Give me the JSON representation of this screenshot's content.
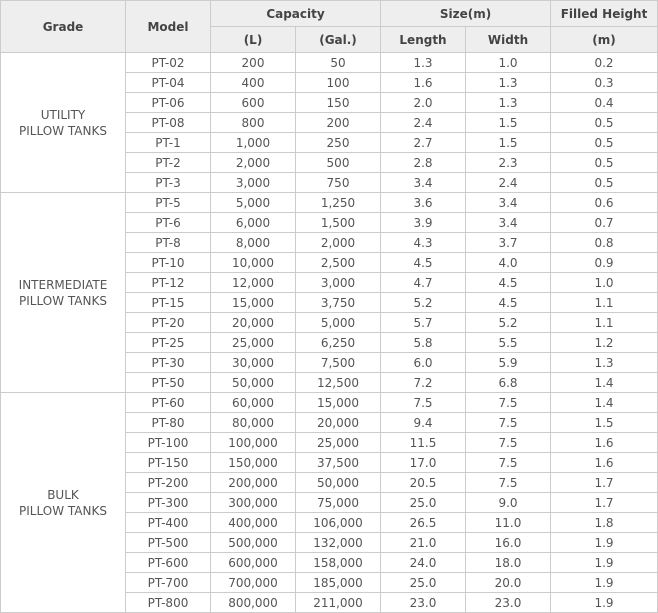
{
  "headers": {
    "grade": "Grade",
    "model": "Model",
    "capacity": "Capacity",
    "size": "Size(m)",
    "filled_height": "Filled Height",
    "liters": "(L)",
    "gallons": "(Gal.)",
    "length": "Length",
    "width": "Width",
    "meters": "(m)"
  },
  "groups": [
    {
      "grade": [
        "UTILITY",
        "PILLOW TANKS"
      ],
      "rows": [
        [
          "PT-02",
          "200",
          "50",
          "1.3",
          "1.0",
          "0.2"
        ],
        [
          "PT-04",
          "400",
          "100",
          "1.6",
          "1.3",
          "0.3"
        ],
        [
          "PT-06",
          "600",
          "150",
          "2.0",
          "1.3",
          "0.4"
        ],
        [
          "PT-08",
          "800",
          "200",
          "2.4",
          "1.5",
          "0.5"
        ],
        [
          "PT-1",
          "1,000",
          "250",
          "2.7",
          "1.5",
          "0.5"
        ],
        [
          "PT-2",
          "2,000",
          "500",
          "2.8",
          "2.3",
          "0.5"
        ],
        [
          "PT-3",
          "3,000",
          "750",
          "3.4",
          "2.4",
          "0.5"
        ]
      ]
    },
    {
      "grade": [
        "INTERMEDIATE",
        "PILLOW TANKS"
      ],
      "rows": [
        [
          "PT-5",
          "5,000",
          "1,250",
          "3.6",
          "3.4",
          "0.6"
        ],
        [
          "PT-6",
          "6,000",
          "1,500",
          "3.9",
          "3.4",
          "0.7"
        ],
        [
          "PT-8",
          "8,000",
          "2,000",
          "4.3",
          "3.7",
          "0.8"
        ],
        [
          "PT-10",
          "10,000",
          "2,500",
          "4.5",
          "4.0",
          "0.9"
        ],
        [
          "PT-12",
          "12,000",
          "3,000",
          "4.7",
          "4.5",
          "1.0"
        ],
        [
          "PT-15",
          "15,000",
          "3,750",
          "5.2",
          "4.5",
          "1.1"
        ],
        [
          "PT-20",
          "20,000",
          "5,000",
          "5.7",
          "5.2",
          "1.1"
        ],
        [
          "PT-25",
          "25,000",
          "6,250",
          "5.8",
          "5.5",
          "1.2"
        ],
        [
          "PT-30",
          "30,000",
          "7,500",
          "6.0",
          "5.9",
          "1.3"
        ],
        [
          "PT-50",
          "50,000",
          "12,500",
          "7.2",
          "6.8",
          "1.4"
        ]
      ]
    },
    {
      "grade": [
        "BULK",
        "PILLOW TANKS"
      ],
      "rows": [
        [
          "PT-60",
          "60,000",
          "15,000",
          "7.5",
          "7.5",
          "1.4"
        ],
        [
          "PT-80",
          "80,000",
          "20,000",
          "9.4",
          "7.5",
          "1.5"
        ],
        [
          "PT-100",
          "100,000",
          "25,000",
          "11.5",
          "7.5",
          "1.6"
        ],
        [
          "PT-150",
          "150,000",
          "37,500",
          "17.0",
          "7.5",
          "1.6"
        ],
        [
          "PT-200",
          "200,000",
          "50,000",
          "20.5",
          "7.5",
          "1.7"
        ],
        [
          "PT-300",
          "300,000",
          "75,000",
          "25.0",
          "9.0",
          "1.7"
        ],
        [
          "PT-400",
          "400,000",
          "106,000",
          "26.5",
          "11.0",
          "1.8"
        ],
        [
          "PT-500",
          "500,000",
          "132,000",
          "21.0",
          "16.0",
          "1.9"
        ],
        [
          "PT-600",
          "600,000",
          "158,000",
          "24.0",
          "18.0",
          "1.9"
        ],
        [
          "PT-700",
          "700,000",
          "185,000",
          "25.0",
          "20.0",
          "1.9"
        ],
        [
          "PT-800",
          "800,000",
          "211,000",
          "23.0",
          "23.0",
          "1.9"
        ]
      ]
    }
  ]
}
